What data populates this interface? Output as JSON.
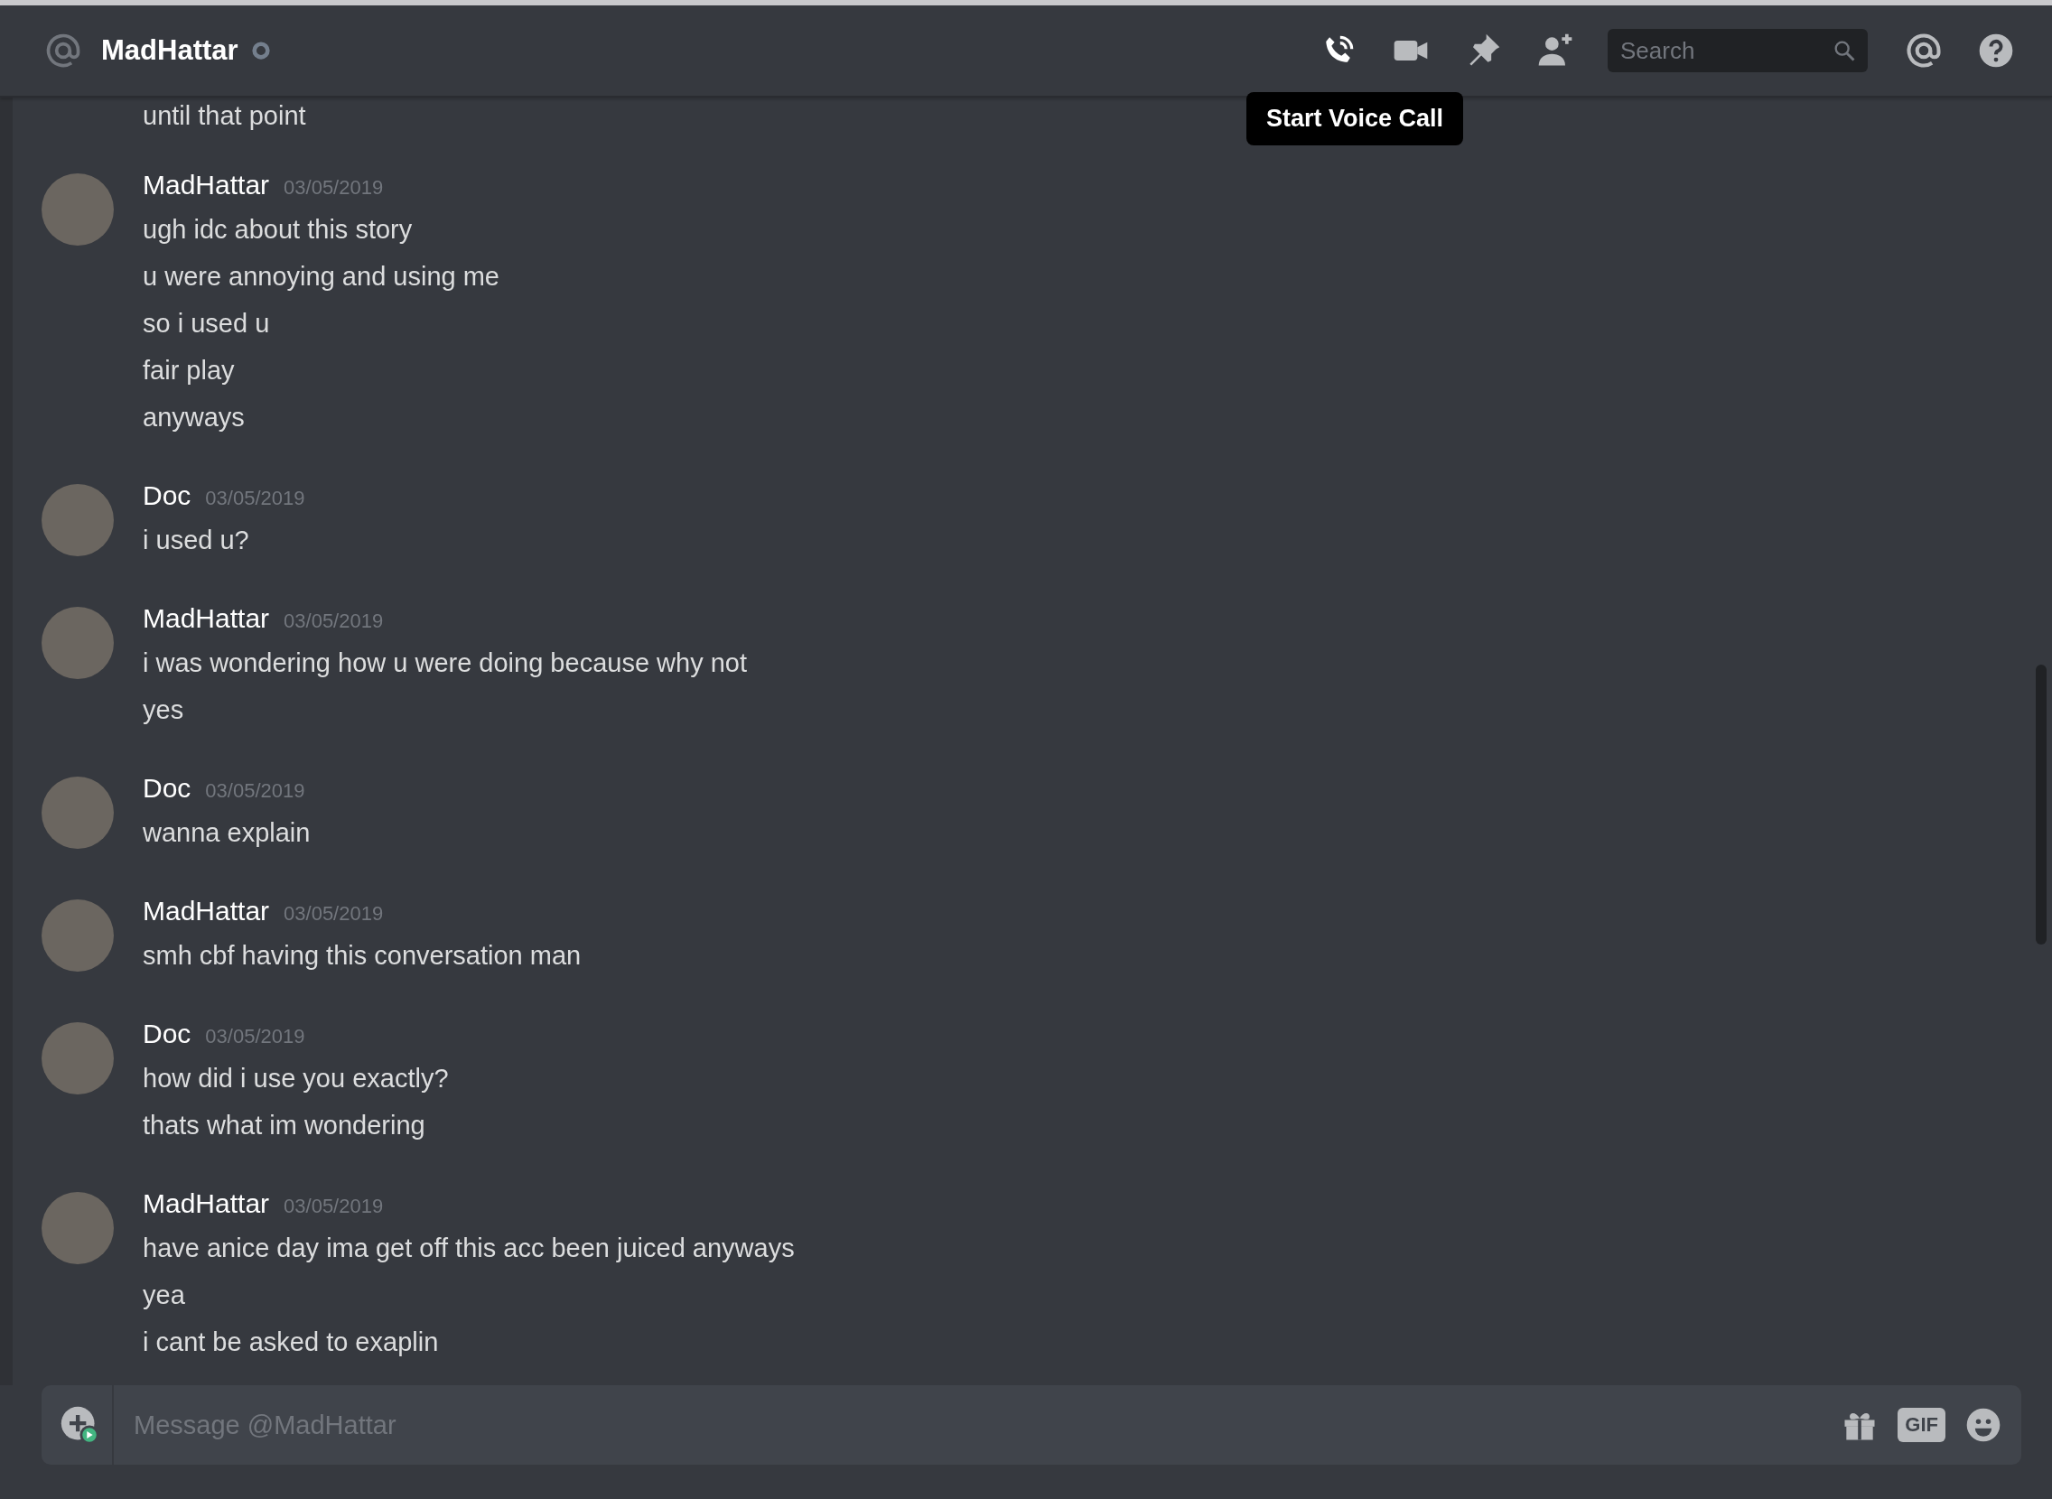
{
  "header": {
    "title": "MadHattar",
    "search": {
      "placeholder": "Search"
    },
    "tooltip": "Start Voice Call"
  },
  "messages": [
    {
      "lines": [
        "until that point"
      ]
    },
    {
      "author": "MadHattar",
      "timestamp": "03/05/2019",
      "lines": [
        "ugh idc about this story",
        "u were annoying and using me",
        "so i used u",
        "fair play",
        "anyways"
      ]
    },
    {
      "author": "Doc",
      "timestamp": "03/05/2019",
      "lines": [
        "i used u?"
      ]
    },
    {
      "author": "MadHattar",
      "timestamp": "03/05/2019",
      "lines": [
        "i was wondering how u were doing because why not",
        "yes"
      ]
    },
    {
      "author": "Doc",
      "timestamp": "03/05/2019",
      "lines": [
        "wanna explain"
      ]
    },
    {
      "author": "MadHattar",
      "timestamp": "03/05/2019",
      "lines": [
        "smh cbf having this conversation man"
      ]
    },
    {
      "author": "Doc",
      "timestamp": "03/05/2019",
      "lines": [
        "how did i use you exactly?",
        "thats what im wondering"
      ]
    },
    {
      "author": "MadHattar",
      "timestamp": "03/05/2019",
      "lines": [
        "have anice day ima get off this acc been juiced anyways",
        "yea",
        "i cant be asked to exaplin"
      ]
    }
  ],
  "composer": {
    "placeholder": "Message @MadHattar",
    "gif_label": "GIF"
  }
}
